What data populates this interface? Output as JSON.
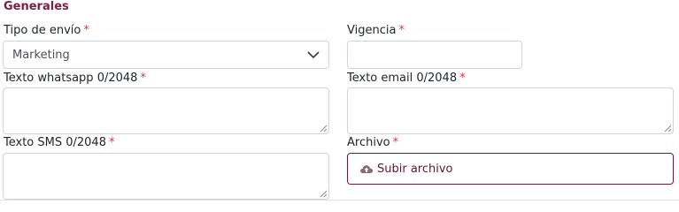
{
  "section": {
    "title": "Generales"
  },
  "required_mark": "*",
  "fields": {
    "tipo_envio": {
      "label": "Tipo de envío",
      "value": "Marketing"
    },
    "vigencia": {
      "label": "Vigencia",
      "value": ""
    },
    "texto_whatsapp": {
      "label": "Texto whatsapp 0/2048",
      "value": ""
    },
    "texto_email": {
      "label": "Texto email 0/2048",
      "value": ""
    },
    "texto_sms": {
      "label": "Texto SMS 0/2048",
      "value": ""
    },
    "archivo": {
      "label": "Archivo",
      "button_label": "Subir archivo",
      "icon": "cloud-upload-icon"
    }
  },
  "colors": {
    "accent": "#7a1f3d",
    "required": "#dc3545",
    "border": "#ced4da"
  }
}
